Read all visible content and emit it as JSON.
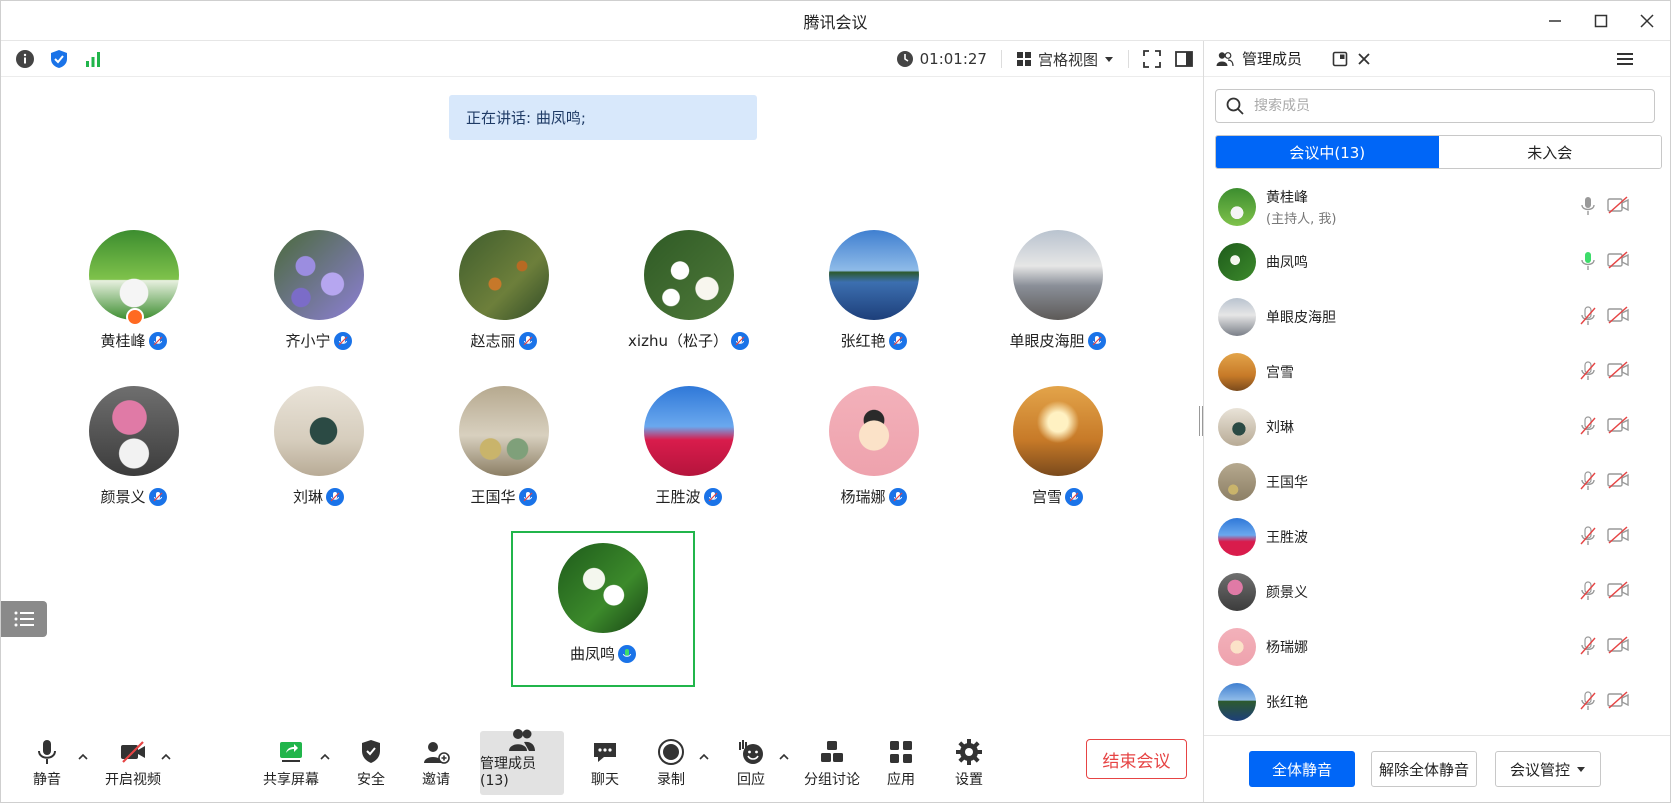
{
  "window": {
    "title": "腾讯会议"
  },
  "topbar": {
    "timer": "01:01:27",
    "view_mode": "宫格视图"
  },
  "speaking_banner": "正在讲话: 曲凤鸣;",
  "grid": [
    {
      "name": "黄桂峰",
      "host": true,
      "bg": "radial-gradient(circle at 50% 70%, #f5f5f5 0 18%, transparent 19%), linear-gradient(#3c8d2f, #7fc24b 55%, #e8f0e0 56%, #3c8d2f)"
    },
    {
      "name": "齐小宁",
      "host": false,
      "bg": "radial-gradient(circle at 35% 40%, #9b8de0 0 12%, transparent 13%), radial-gradient(circle at 65% 60%, #b6a6f0 0 14%, transparent 15%), radial-gradient(circle at 30% 75%, #7b6cc8 0 10%, transparent 11%), linear-gradient(135deg,#4a6a3a,#8d7fd6)"
    },
    {
      "name": "赵志丽",
      "host": false,
      "bg": "radial-gradient(circle at 40% 60%, #c6782a 0 8%, transparent 9%), radial-gradient(circle at 70% 40%, #b86a23 0 6%, transparent 7%), linear-gradient(135deg,#3f5d2d,#6d7f3b 60%,#2f4a26)"
    },
    {
      "name": "xizhu（松子）",
      "host": false,
      "bg": "radial-gradient(circle at 40% 45%, #fff 0 12%, transparent 13%), radial-gradient(circle at 70% 65%, #f8f6ee 0 13%, transparent 14%), radial-gradient(circle at 30% 75%, #fff 0 9%, transparent 10%), linear-gradient(135deg,#2f5a25,#4f7a3a)"
    },
    {
      "name": "张红艳",
      "host": false,
      "bg": "linear-gradient(#3f7fd0, #8fbbe8 45%, #2d5a2f 47%, #3c6fb0 58%, #1d3f7a)"
    },
    {
      "name": "单眼皮海胆",
      "host": false,
      "bg": "linear-gradient(#b9c3cf, #e6e6e6 40%, #8a8f98 62%, #5d5a58)"
    },
    {
      "name": "颜景义",
      "host": false,
      "bg": "radial-gradient(circle at 45% 35%, #e07aa6 0 22%, transparent 23%), radial-gradient(circle at 50% 75%, #f2f2f2 0 18%, transparent 19%), linear-gradient(#6f6f6f,#3c3c3c)"
    },
    {
      "name": "刘琳",
      "host": false,
      "bg": "radial-gradient(circle at 55% 50%, #2b4a44 0 20%, transparent 21%), linear-gradient(#e9e3d8,#d6cdbd 60%,#b8ab96)"
    },
    {
      "name": "王国华",
      "host": false,
      "bg": "radial-gradient(circle at 35% 70%, #c9b46b 0 12%, transparent 13%), radial-gradient(circle at 65% 70%, #7fa07a 0 12%, transparent 13%), linear-gradient(#b6a98f,#d8d0bf 55%,#8c7f65)"
    },
    {
      "name": "王胜波",
      "host": false,
      "bg": "linear-gradient(#2f78d8, #6aa8ee 45%, #d91c4c 60%, #b5143c)"
    },
    {
      "name": "杨瑞娜",
      "host": false,
      "bg": "radial-gradient(circle at 50% 55%, #fbe2c8 0 22%, transparent 23%), radial-gradient(circle at 50% 38%, #2a2a2a 0 14%, transparent 15%), linear-gradient(#f3b1ba,#eea2ad)"
    },
    {
      "name": "宫雪",
      "host": false,
      "bg": "radial-gradient(circle at 50% 40%, #fff1c2 0 14%, transparent 30%), linear-gradient(#e3a44a,#c77a28 60%,#7a4a1c)"
    }
  ],
  "active_speaker": {
    "name": "曲凤鸣",
    "bg": "radial-gradient(circle at 40% 40%, #f4f7ee 0 14%, transparent 15%), radial-gradient(circle at 62% 58%, #ffffff 0 13%, transparent 14%), linear-gradient(135deg,#1e5b1b,#3c8a2b 60%,#174214)"
  },
  "toolbar": {
    "mute": "静音",
    "video": "开启视频",
    "share": "共享屏幕",
    "security": "安全",
    "invite": "邀请",
    "members": "管理成员(13)",
    "chat": "聊天",
    "record": "录制",
    "react": "回应",
    "breakout": "分组讨论",
    "apps": "应用",
    "settings": "设置",
    "end": "结束会议"
  },
  "panel": {
    "title": "管理成员",
    "search_placeholder": "搜索成员",
    "tab_in": "会议中(13)",
    "tab_out": "未入会",
    "members": [
      {
        "name": "黄桂峰",
        "sub": "(主持人, 我)",
        "mic": "on-gray",
        "bg": "radial-gradient(circle at 50% 65%, #f5f5f5 0 20%, transparent 21%), linear-gradient(#3c8d2f,#7fc24b)"
      },
      {
        "name": "曲凤鸣",
        "sub": "",
        "mic": "on-green",
        "bg": "radial-gradient(circle at 45% 45%, #f4f7ee 0 16%, transparent 17%), linear-gradient(135deg,#1e5b1b,#3c8a2b)"
      },
      {
        "name": "单眼皮海胆",
        "sub": "",
        "mic": "off",
        "bg": "linear-gradient(#b9c3cf,#e6e6e6 45%,#7a7f88)"
      },
      {
        "name": "宫雪",
        "sub": "",
        "mic": "off",
        "bg": "linear-gradient(#e3a44a,#c77a28 60%,#7a4a1c)"
      },
      {
        "name": "刘琳",
        "sub": "",
        "mic": "off",
        "bg": "radial-gradient(circle at 55% 55%, #2b4a44 0 22%, transparent 23%), linear-gradient(#e9e3d8,#b8ab96)"
      },
      {
        "name": "王国华",
        "sub": "",
        "mic": "off",
        "bg": "radial-gradient(circle at 40% 70%, #c9b46b 0 14%, transparent 15%), linear-gradient(#b6a98f,#8c7f65)"
      },
      {
        "name": "王胜波",
        "sub": "",
        "mic": "off",
        "bg": "linear-gradient(#2f78d8,#6aa8ee 45%,#d91c4c 62%)"
      },
      {
        "name": "颜景义",
        "sub": "",
        "mic": "off",
        "bg": "radial-gradient(circle at 45% 38%, #e07aa6 0 24%, transparent 25%), linear-gradient(#6f6f6f,#3c3c3c)"
      },
      {
        "name": "杨瑞娜",
        "sub": "",
        "mic": "off",
        "bg": "radial-gradient(circle at 50% 50%, #fbe2c8 0 24%, transparent 25%), linear-gradient(#f3b1ba,#eea2ad)"
      },
      {
        "name": "张红艳",
        "sub": "",
        "mic": "off",
        "bg": "linear-gradient(#3f7fd0,#8fbbe8 45%,#2d5a2f 48%,#1d3f7a)"
      }
    ],
    "btn_mute_all": "全体静音",
    "btn_unmute_all": "解除全体静音",
    "btn_control": "会议管控"
  },
  "colors": {
    "accent": "#0066f7",
    "danger": "#e64444",
    "active_border": "#21b54b",
    "banner_bg": "#d8e8fb"
  }
}
